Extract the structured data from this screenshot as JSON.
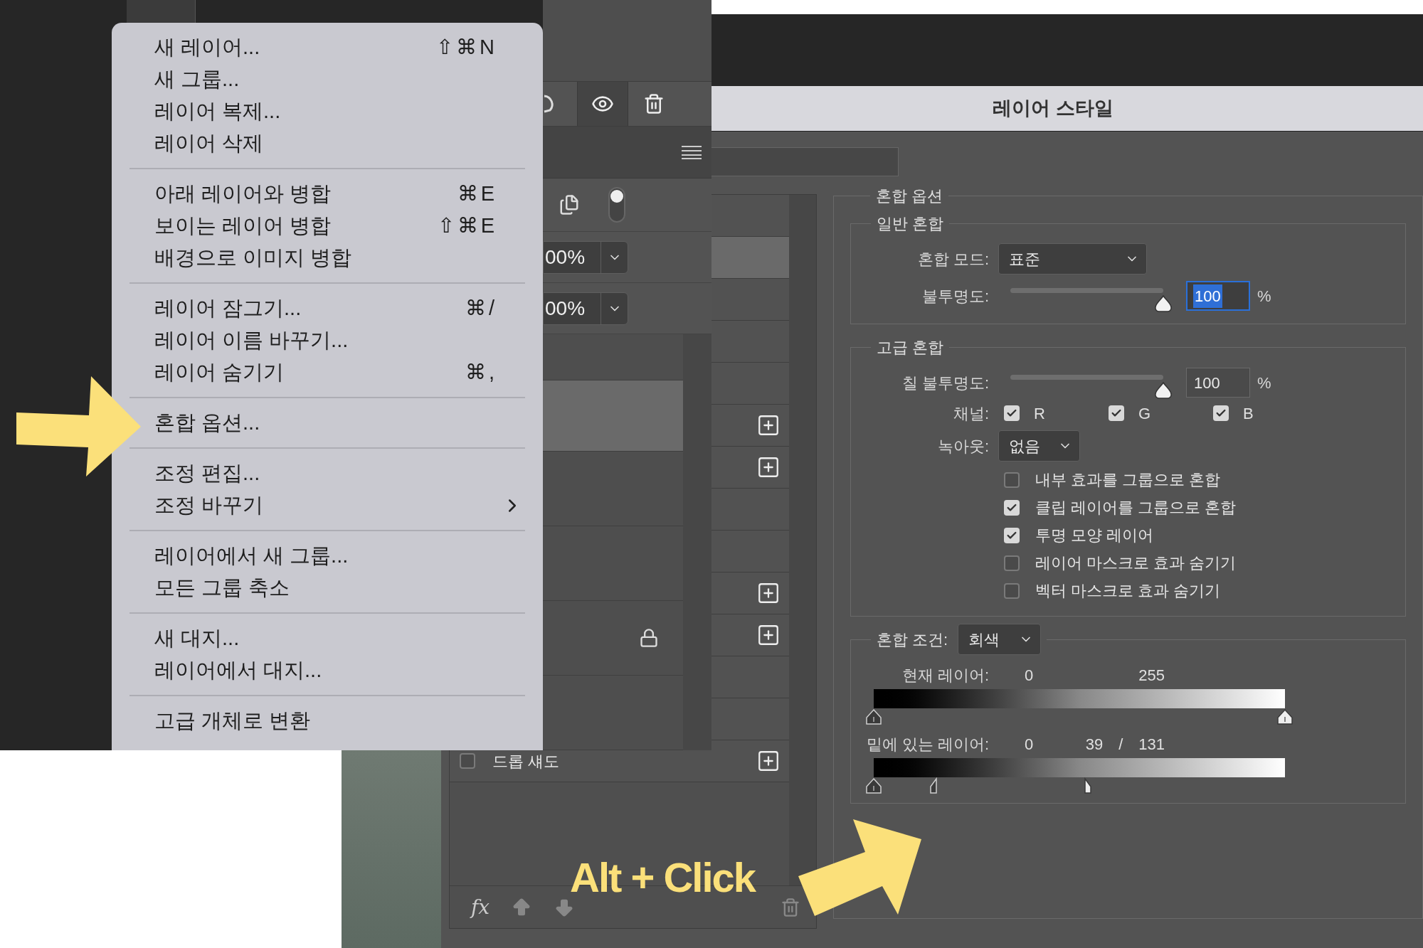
{
  "layers_panel": {
    "toggle": {
      "on": true
    },
    "opacity_fields": [
      {
        "value": "00%"
      },
      {
        "value": "00%"
      }
    ],
    "rows": [
      {
        "selected": false,
        "locked": false
      },
      {
        "selected": true,
        "locked": false
      },
      {
        "selected": false,
        "locked": false
      },
      {
        "selected": false,
        "locked": false
      },
      {
        "selected": false,
        "locked": true
      },
      {
        "selected": false,
        "locked": false
      }
    ]
  },
  "context_menu": {
    "groups": [
      {
        "items": [
          {
            "label": "새 레이어...",
            "shortcut": "⇧⌘N"
          },
          {
            "label": "새 그룹..."
          },
          {
            "label": "레이어 복제..."
          },
          {
            "label": "레이어 삭제"
          }
        ]
      },
      {
        "items": [
          {
            "label": "아래 레이어와 병합",
            "shortcut": "⌘E"
          },
          {
            "label": "보이는 레이어 병합",
            "shortcut": "⇧⌘E"
          },
          {
            "label": "배경으로 이미지 병합"
          }
        ]
      },
      {
        "items": [
          {
            "label": "레이어 잠그기...",
            "shortcut": "⌘/"
          },
          {
            "label": "레이어 이름 바꾸기..."
          },
          {
            "label": "레이어 숨기기",
            "shortcut": "⌘,"
          }
        ]
      },
      {
        "items": [
          {
            "label": "혼합 옵션..."
          }
        ]
      },
      {
        "items": [
          {
            "label": "조정 편집..."
          },
          {
            "label": "조정 바꾸기",
            "submenu": true
          }
        ]
      },
      {
        "items": [
          {
            "label": "레이어에서 새 그룹..."
          },
          {
            "label": "모든 그룹 축소"
          }
        ]
      },
      {
        "items": [
          {
            "label": "새 대지..."
          },
          {
            "label": "레이어에서 대지..."
          }
        ]
      },
      {
        "items": [
          {
            "label": "고급 개체로 변환"
          }
        ]
      }
    ]
  },
  "annotation": {
    "text": "Alt + Click"
  },
  "dialog": {
    "title": "레이어 스타일",
    "styles_list": [
      {
        "selected": false,
        "plus": false
      },
      {
        "selected": true,
        "plus": false
      },
      {
        "selected": false,
        "plus": false
      },
      {
        "selected": false,
        "plus": false
      },
      {
        "selected": false,
        "plus": false
      },
      {
        "selected": false,
        "plus": true
      },
      {
        "selected": false,
        "plus": true
      },
      {
        "selected": false,
        "plus": false
      },
      {
        "selected": false,
        "plus": false
      },
      {
        "selected": false,
        "plus": true
      },
      {
        "selected": false,
        "plus": true
      },
      {
        "selected": false,
        "plus": false
      },
      {
        "selected": false,
        "plus": false
      },
      {
        "label": "드롭 섀도",
        "checked": false,
        "selected": false,
        "plus": true
      }
    ],
    "toolbar": {
      "fx": "fx"
    },
    "blending_options": {
      "legend": "혼합 옵션",
      "general": {
        "legend": "일반 혼합",
        "mode": {
          "label": "혼합 모드:",
          "value": "표준"
        },
        "opacity": {
          "label": "불투명도:",
          "level": 1,
          "value": "100",
          "unit": "%",
          "focused": true
        }
      },
      "advanced": {
        "legend": "고급 혼합",
        "fill_opacity": {
          "label": "칠 불투명도:",
          "level": 1,
          "value": "100",
          "unit": "%",
          "focused": false
        },
        "channels": {
          "label": "채널:",
          "items": [
            {
              "label": "R",
              "checked": true
            },
            {
              "label": "G",
              "checked": true
            },
            {
              "label": "B",
              "checked": true
            }
          ]
        },
        "knockout": {
          "label": "녹아웃:",
          "value": "없음"
        },
        "options": [
          {
            "label": "내부 효과를 그룹으로 혼합",
            "checked": false
          },
          {
            "label": "클립 레이어를 그룹으로 혼합",
            "checked": true
          },
          {
            "label": "투명 모양 레이어",
            "checked": true
          },
          {
            "label": "레이어 마스크로 효과 숨기기",
            "checked": false
          },
          {
            "label": "벡터 마스크로 효과 숨기기",
            "checked": false
          }
        ]
      },
      "blend_if": {
        "label": "혼합 조건:",
        "value": "회색",
        "bars": [
          {
            "label": "현재 레이어:",
            "values": [
              "0",
              "255"
            ],
            "thumbs": [
              {
                "kind": "black",
                "level": 0
              },
              {
                "kind": "white",
                "level": 1
              }
            ]
          },
          {
            "label": "밑에 있는 레이어:",
            "values": [
              "0",
              "39",
              "/",
              "131"
            ],
            "thumbs": [
              {
                "kind": "black",
                "level": 0
              },
              {
                "kind": "black_split",
                "level": 0.153
              },
              {
                "kind": "white_split",
                "level": 0.514
              }
            ]
          }
        ]
      }
    }
  }
}
